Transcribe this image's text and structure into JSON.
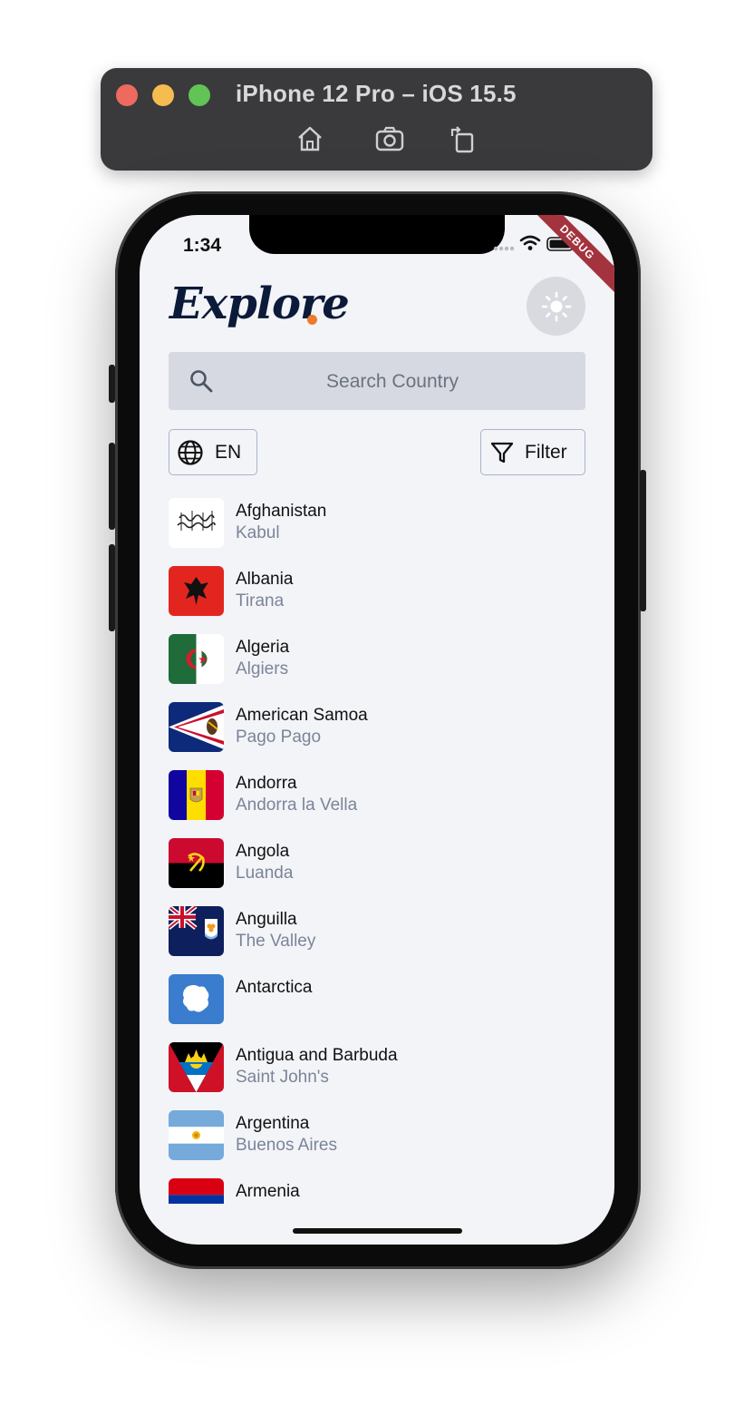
{
  "simulator": {
    "title": "iPhone 12 Pro – iOS 15.5",
    "toolbar_icons": [
      "home-icon",
      "screenshot-icon",
      "rotate-icon"
    ]
  },
  "status_bar": {
    "time": "1:34",
    "debug_label": "DEBUG"
  },
  "header": {
    "title": "Explore",
    "accent_color": "#ef7a2e",
    "theme_icon": "sun-icon"
  },
  "search": {
    "placeholder": "Search Country",
    "value": ""
  },
  "controls": {
    "language_label": "EN",
    "filter_label": "Filter"
  },
  "countries": [
    {
      "name": "Afghanistan",
      "capital": "Kabul"
    },
    {
      "name": "Albania",
      "capital": "Tirana"
    },
    {
      "name": "Algeria",
      "capital": "Algiers"
    },
    {
      "name": "American Samoa",
      "capital": "Pago Pago"
    },
    {
      "name": "Andorra",
      "capital": "Andorra la Vella"
    },
    {
      "name": "Angola",
      "capital": "Luanda"
    },
    {
      "name": "Anguilla",
      "capital": "The Valley"
    },
    {
      "name": "Antarctica",
      "capital": ""
    },
    {
      "name": "Antigua and Barbuda",
      "capital": "Saint John's"
    },
    {
      "name": "Argentina",
      "capital": "Buenos Aires"
    },
    {
      "name": "Armenia",
      "capital": ""
    }
  ]
}
